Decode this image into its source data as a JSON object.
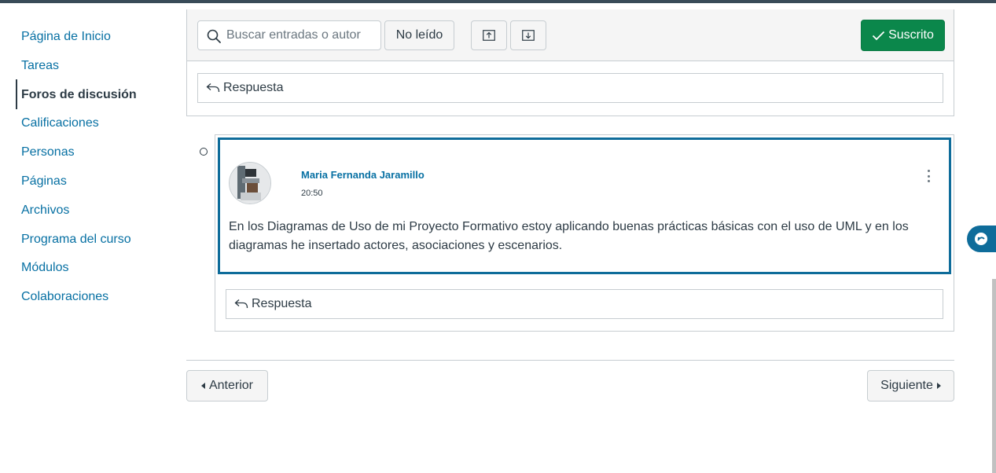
{
  "sidebar": {
    "items": [
      {
        "label": "Página de Inicio"
      },
      {
        "label": "Tareas"
      },
      {
        "label": "Foros de discusión"
      },
      {
        "label": "Calificaciones"
      },
      {
        "label": "Personas"
      },
      {
        "label": "Páginas"
      },
      {
        "label": "Archivos"
      },
      {
        "label": "Programa del curso"
      },
      {
        "label": "Módulos"
      },
      {
        "label": "Colaboraciones"
      }
    ],
    "active": "Foros de discusión"
  },
  "toolbar": {
    "search_placeholder": "Buscar entradas o autor",
    "unread_label": "No leído",
    "subscribed_label": "Suscrito"
  },
  "top_reply": {
    "label": "Respuesta"
  },
  "entry": {
    "author": "Maria Fernanda Jaramillo",
    "time": "20:50",
    "message": "En los Diagramas de Uso de mi Proyecto Formativo estoy aplicando buenas prácticas básicas con el uso de UML y en los diagramas he insertado actores, asociaciones y escenarios.",
    "reply_label": "Respuesta"
  },
  "pagination": {
    "prev_label": "Anterior",
    "next_label": "Siguiente"
  },
  "colors": {
    "link": "#0770a3",
    "subscribed_bg": "#0b874b",
    "entry_border": "#0e6c9a"
  }
}
